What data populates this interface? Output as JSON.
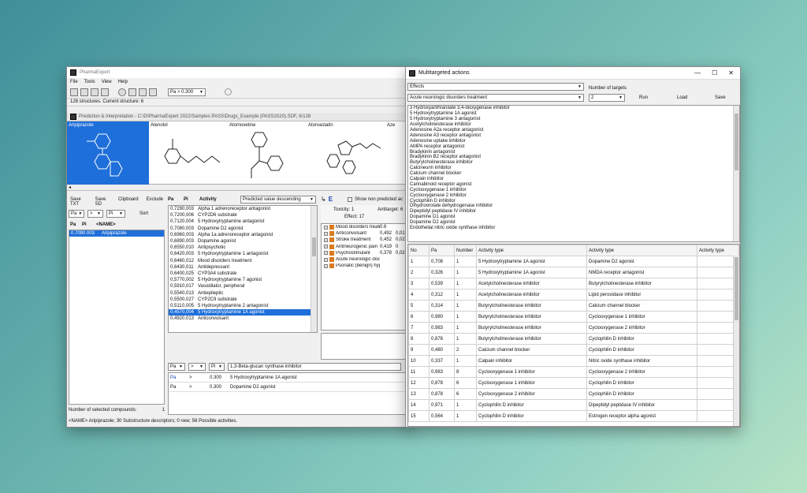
{
  "main_window": {
    "title": "PharmaExpert",
    "menu": [
      "File",
      "Tools",
      "View",
      "Help"
    ],
    "pa_filter": "Pa > 0.300",
    "status": "128 structures. Current structure: 6",
    "subwindow_title": "Prediction & Interpretation - C:\\D\\PharmaExpert 2022\\Samples PASS\\Drugs_Example (PASS2020).SDF, 6/128",
    "structures": [
      {
        "name": "Aripiprazole"
      },
      {
        "name": "Atenolol"
      },
      {
        "name": "Atomoxetine"
      },
      {
        "name": "Atorvastatin"
      },
      {
        "name": "Aze"
      }
    ],
    "left_buttons": [
      "Save TXT",
      "Save SD",
      "Clipboard",
      "Exclude"
    ],
    "filter_pa": "Pa",
    "filter_op": ">",
    "filter_pi": "Pi",
    "sort_label": "Sort",
    "compound_headers": [
      "Pa",
      "Pi",
      "<NAME>"
    ],
    "compounds": [
      {
        "pa": "0.709",
        "pi": "0.003",
        "name": "Aripiprazole"
      }
    ],
    "selected_count_label": "Number of selected compounds:",
    "selected_count": "1",
    "activity_headers": [
      "Pa",
      "Pi",
      "Activity"
    ],
    "sort_mode": "Predicted value descending",
    "activities": [
      {
        "pa": "0,729",
        "pi": "0,003",
        "name": "Alpha 1 adrenoreceptor antagonist"
      },
      {
        "pa": "0,720",
        "pi": "0,006",
        "name": "CYP2D6 substrate"
      },
      {
        "pa": "0,712",
        "pi": "0,004",
        "name": "5 Hydroxytryptamine antagonist"
      },
      {
        "pa": "0,708",
        "pi": "0,003",
        "name": "Dopamine D2 agonist"
      },
      {
        "pa": "0,696",
        "pi": "0,003",
        "name": "Alpha 1a adrenoreceptor antagonist"
      },
      {
        "pa": "0,689",
        "pi": "0,003",
        "name": "Dopamine agonist"
      },
      {
        "pa": "0,655",
        "pi": "0,010",
        "name": "Antipsychotic"
      },
      {
        "pa": "0,642",
        "pi": "0,003",
        "name": "5 Hydroxytryptamine 1 antagonist"
      },
      {
        "pa": "0,646",
        "pi": "0,012",
        "name": "Mood disorders treatment"
      },
      {
        "pa": "0,643",
        "pi": "0,011",
        "name": "Antidepressant"
      },
      {
        "pa": "0,640",
        "pi": "0,025",
        "name": "CYP3A4 substrate"
      },
      {
        "pa": "0,577",
        "pi": "0,002",
        "name": "5 Hydroxytryptamine 7 agonist"
      },
      {
        "pa": "0,591",
        "pi": "0,017",
        "name": "Vasodilator, peripheral"
      },
      {
        "pa": "0,554",
        "pi": "0,013",
        "name": "Antiepileptic"
      },
      {
        "pa": "0,550",
        "pi": "0,027",
        "name": "CYP2C9 substrate"
      },
      {
        "pa": "0,511",
        "pi": "0,005",
        "name": "5 Hydroxytryptamine 2 antagonist"
      },
      {
        "pa": "0,457",
        "pi": "0,004",
        "name": "5 Hydroxytryptamine 1A agonist"
      },
      {
        "pa": "0,492",
        "pi": "0,013",
        "name": "Anticonvulsant"
      }
    ],
    "show_non_predicted": "Show non predicted ac",
    "toxicity_label": "Toxicity: 1",
    "antitarget_label": "Antitarget: 6",
    "effect_label": "Effect: 17",
    "effects": [
      {
        "name": "Mood disorders treatment",
        "pa": "0.6"
      },
      {
        "name": "Anticonvulsant",
        "pa": "0,492",
        "pi": "0,013"
      },
      {
        "name": "Stroke treatment",
        "pa": "0,452",
        "pi": "0,02"
      },
      {
        "name": "Antineurogenic pain",
        "pa": "0,419",
        "pi": "0"
      },
      {
        "name": "Psychostimulant",
        "pa": "0,378",
        "pi": "0,02"
      },
      {
        "name": "Acute neurologic disorders tre"
      },
      {
        "name": "Psoriatic (benign) hyperplasia tr"
      }
    ],
    "bottom_filter_pa": "Pa",
    "bottom_filter_op": ">",
    "bottom_filter_pi": "Pi",
    "bottom_filter_activity": "1,3-Beta-glucan synthase inhibitor",
    "bottom_rows": [
      {
        "k": "Pa",
        "op": ">",
        "v": "0.300",
        "name": "5 Hydroxytryptamine 1A agonist"
      },
      {
        "k": "Pa",
        "op": ">",
        "v": "0.300",
        "name": "Dopamine D2 agonist"
      }
    ],
    "statusbar": "<NAME> Aripiprazole; 30 Substructure descriptors; 0 new; 56 Possible activities."
  },
  "multi_window": {
    "title": "Multitargeted actions",
    "controls": {
      "minimize": "—",
      "maximize": "☐",
      "close": "✕"
    },
    "effects_combo": "Effects",
    "selected_effect": "Acute neurologic disorders treatment",
    "targets_label": "Number of targets",
    "targets_value": "2",
    "run_label": "Run",
    "load_label": "Load",
    "save_label": "Save",
    "targets_list": [
      "3 Hydroxyanthranilate 3,4-dioxygenase inhibitor",
      "5 Hydroxytryptamine 1A agonist",
      "5 Hydroxytryptamine 3 antagonist",
      "Acetylcholinesterase inhibitor",
      "Adenosine A2a receptor antagonist",
      "Adenosine A3 receptor antagonist",
      "Adenosine uptake inhibitor",
      "AMPA receptor antagonist",
      "Bradykinin antagonist",
      "Bradykinin B2 receptor antagonist",
      "Butyrylcholinesterase inhibitor",
      "Calcineurin inhibitor",
      "Calcium channel blocker",
      "Calpain inhibitor",
      "Cannabinoid receptor agonist",
      "Cyclooxygenase 1 inhibitor",
      "Cyclooxygenase 2 inhibitor",
      "Cyclophilin D inhibitor",
      "Dihydroorotate dehydrogenase inhibitor",
      "Dipeptidyl peptidase IV inhibitor",
      "Dopamine D1 agonist",
      "Dopamine D2 agonist",
      "Endothelial nitric oxide synthase inhibitor"
    ],
    "table_headers": [
      "No",
      "Pa",
      "Number",
      "Activity type",
      "Activity type",
      "Activity type"
    ],
    "table_rows": [
      [
        "1",
        "0,708",
        "1",
        "5 Hydroxytryptamine 1A agonist",
        "Dopamine D2 agonist",
        ""
      ],
      [
        "2",
        "0,326",
        "1",
        "5 Hydroxytryptamine 1A agonist",
        "NMDA receptor antagonist",
        ""
      ],
      [
        "3",
        "0,539",
        "1",
        "Acetylcholinesterase inhibitor",
        "Butyrylcholinesterase inhibitor",
        ""
      ],
      [
        "4",
        "0,312",
        "1",
        "Acetylcholinesterase inhibitor",
        "Lipid peroxidase inhibitor",
        ""
      ],
      [
        "5",
        "0,314",
        "1",
        "Butyrylcholinesterase inhibitor",
        "Calcium channel blocker",
        ""
      ],
      [
        "6",
        "0,980",
        "1",
        "Butyrylcholinesterase inhibitor",
        "Cyclooxygenase 1 inhibitor",
        ""
      ],
      [
        "7",
        "0,983",
        "1",
        "Butyrylcholinesterase inhibitor",
        "Cyclooxygenase 2 inhibitor",
        ""
      ],
      [
        "8",
        "0,878",
        "1",
        "Butyrylcholinesterase inhibitor",
        "Cyclophilin D inhibitor",
        ""
      ],
      [
        "9",
        "0,480",
        "2",
        "Calcium channel blocker",
        "Cyclophilin D inhibitor",
        ""
      ],
      [
        "10",
        "0,337",
        "1",
        "Calpain inhibitor",
        "Nitric oxide synthase inhibitor",
        ""
      ],
      [
        "11",
        "0,983",
        "8",
        "Cyclooxygenase 1 inhibitor",
        "Cyclooxygenase 2 inhibitor",
        ""
      ],
      [
        "12",
        "0,878",
        "6",
        "Cyclooxygenase 1 inhibitor",
        "Cyclophilin D inhibitor",
        ""
      ],
      [
        "13",
        "0,878",
        "6",
        "Cyclooxygenase 2 inhibitor",
        "Cyclophilin D inhibitor",
        ""
      ],
      [
        "14",
        "0,971",
        "1",
        "Cyclophilin D inhibitor",
        "Dipeptidyl peptidase IV inhibitor",
        ""
      ],
      [
        "15",
        "0,564",
        "1",
        "Cyclophilin D inhibitor",
        "Estrogen receptor alpha agonist",
        ""
      ]
    ]
  }
}
